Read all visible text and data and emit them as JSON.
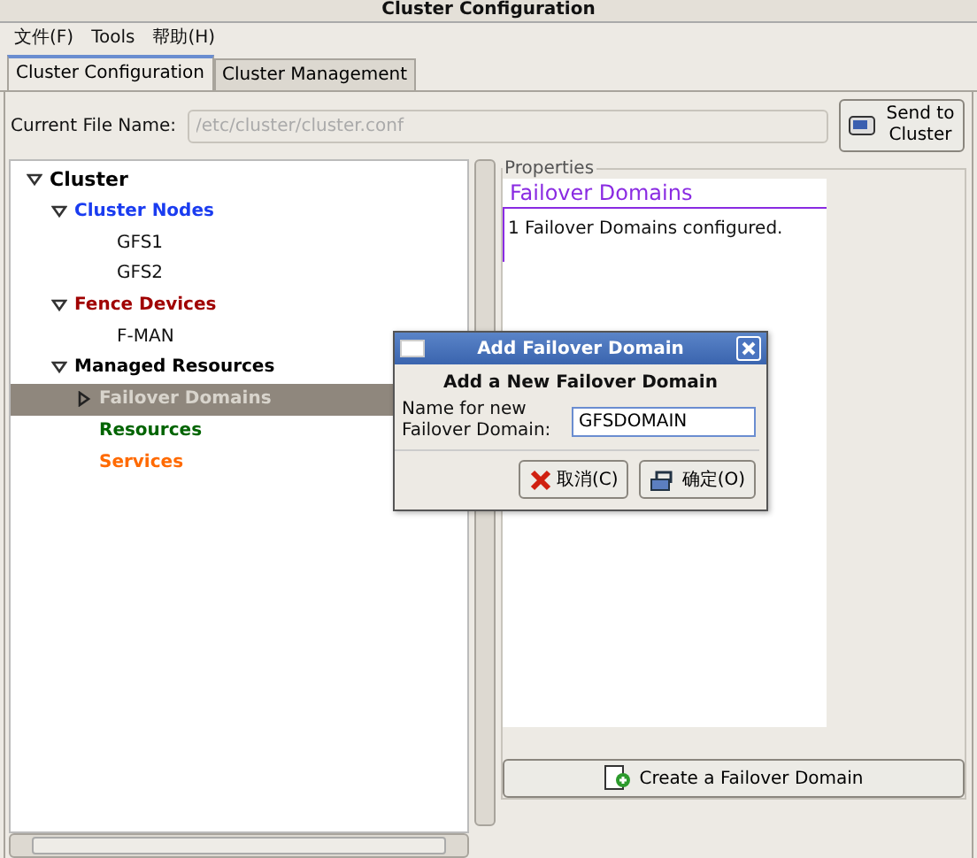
{
  "window": {
    "title": "Cluster Configuration"
  },
  "menu": [
    "文件(F)",
    "Tools",
    "帮助(H)"
  ],
  "tabs": [
    {
      "label": "Cluster Configuration",
      "selected": true
    },
    {
      "label": "Cluster Management",
      "selected": false
    }
  ],
  "file_name": {
    "label": "Current File Name:",
    "value": "/etc/cluster/cluster.conf"
  },
  "send_button": "Send to Cluster",
  "tree": [
    {
      "label": "Cluster",
      "kind": "root",
      "color": "#000000",
      "expanded": true,
      "selected": false,
      "children": [
        {
          "label": "Cluster Nodes",
          "kind": "heading",
          "color": "#1a3cf0",
          "expanded": true,
          "selected": false,
          "children": [
            {
              "label": "GFS1",
              "kind": "leaf",
              "selected": false
            },
            {
              "label": "GFS2",
              "kind": "leaf",
              "selected": false
            }
          ]
        },
        {
          "label": "Fence Devices",
          "kind": "heading",
          "color": "#a00000",
          "expanded": true,
          "selected": false,
          "children": [
            {
              "label": "F-MAN",
              "kind": "leaf",
              "selected": false
            }
          ]
        },
        {
          "label": "Managed Resources",
          "kind": "heading",
          "color": "#000000",
          "expanded": true,
          "selected": false,
          "children": [
            {
              "label": "Failover Domains",
              "kind": "heading",
              "color": "#d8d4cc",
              "expanded": false,
              "selected": true
            },
            {
              "label": "Resources",
              "kind": "heading",
              "color": "#006400",
              "selected": false
            },
            {
              "label": "Services",
              "kind": "heading",
              "color": "#ff6a00",
              "selected": false
            }
          ]
        }
      ]
    }
  ],
  "properties": {
    "legend": "Properties",
    "title": "Failover Domains",
    "text": "1 Failover Domains configured.",
    "button": "Create a Failover Domain"
  },
  "dialog": {
    "title": "Add Failover Domain",
    "heading": "Add a New Failover Domain",
    "label": "Name for new Failover Domain:",
    "value": "GFSDOMAIN",
    "buttons": [
      {
        "label": "取消(C)",
        "kind": "cancel"
      },
      {
        "label": "确定(O)",
        "kind": "ok"
      }
    ]
  }
}
